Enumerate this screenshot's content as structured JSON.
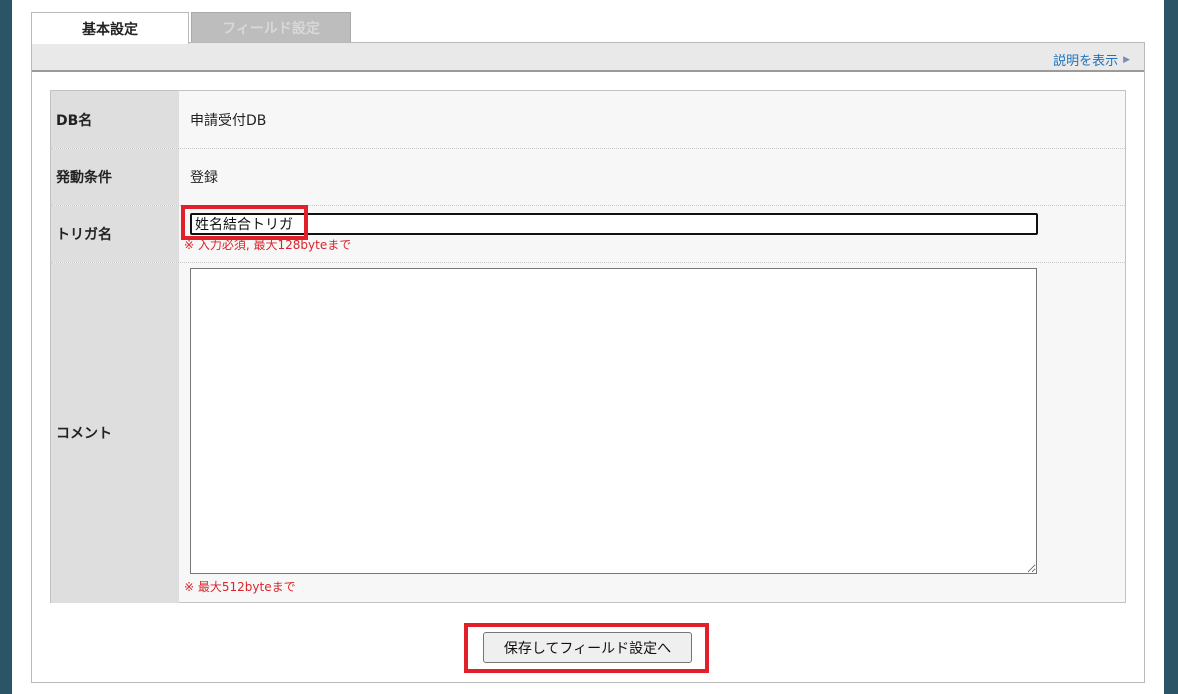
{
  "tabs": [
    {
      "label": "基本設定",
      "active": true
    },
    {
      "label": "フィールド設定",
      "active": false
    }
  ],
  "help": {
    "label": "説明を表示"
  },
  "form": {
    "db_name": {
      "label": "DB名",
      "value": "申請受付DB"
    },
    "trigger_condition": {
      "label": "発動条件",
      "value": "登録"
    },
    "trigger_name": {
      "label": "トリガ名",
      "value": "姓名結合トリガ",
      "note": "※ 入力必須, 最大128byteまで"
    },
    "comment": {
      "label": "コメント",
      "value": "",
      "note": "※ 最大512byteまで"
    }
  },
  "actions": {
    "save_label": "保存してフィールド設定へ"
  },
  "colors": {
    "highlight": "#e2202a",
    "frame": "#2b5466",
    "note": "#d9262c",
    "link": "#1e73be"
  }
}
